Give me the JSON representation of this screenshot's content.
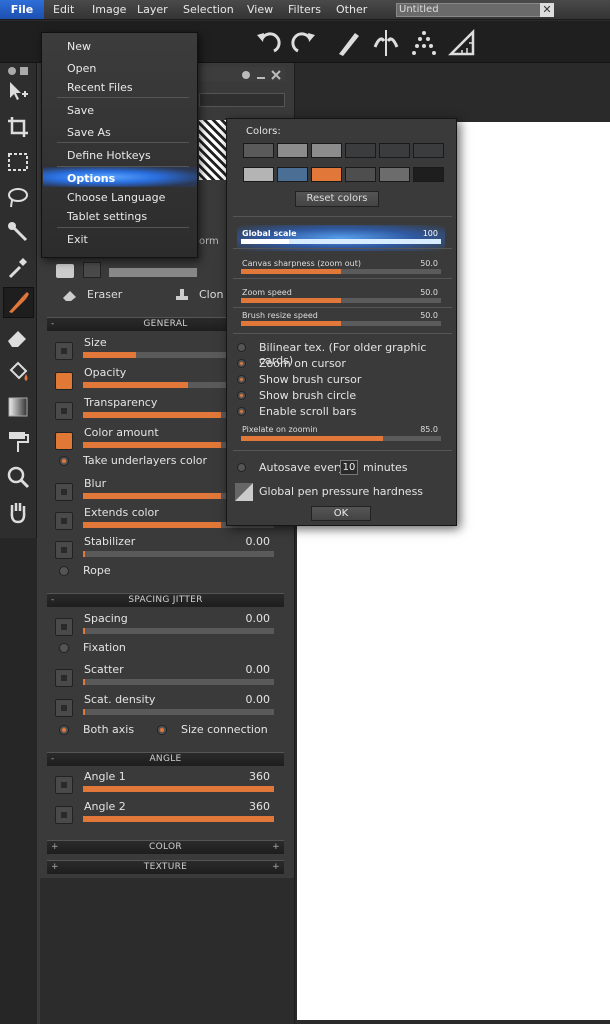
{
  "menubar": {
    "items": [
      "File",
      "Edit",
      "Image",
      "Layer",
      "Selection",
      "View",
      "Filters",
      "Other"
    ],
    "document_name": "Untitled",
    "close_glyph": "✕"
  },
  "file_menu": {
    "items": [
      "New",
      "Open",
      "Recent Files",
      "Save",
      "Save As",
      "Define Hotkeys",
      "Options",
      "Choose Language",
      "Tablet settings",
      "Exit"
    ],
    "highlighted": "Options"
  },
  "partial_panel_text": {
    "form_fragment": "orm",
    "eraser": "Eraser",
    "clone_fragment": "Clon"
  },
  "sections": {
    "general": "GENERAL",
    "spacing_jitter": "SPACING JITTER",
    "angle": "ANGLE",
    "color": "COLOR",
    "texture": "TEXTURE",
    "minus": "-",
    "plus": "+"
  },
  "general_rows": [
    {
      "label": "Size",
      "value": "",
      "fill": 0.28,
      "orange": false
    },
    {
      "label": "Opacity",
      "value": "",
      "fill": 0.55,
      "orange": true
    },
    {
      "label": "Transparency",
      "value": "",
      "fill": 0.72,
      "orange": false
    },
    {
      "label": "Color amount",
      "value": "",
      "fill": 0.72,
      "orange": true
    },
    {
      "label": "Blur",
      "value": "",
      "fill": 0.72,
      "orange": false
    },
    {
      "label": "Extends color",
      "value": "",
      "fill": 0.72,
      "orange": false
    },
    {
      "label": "Stabilizer",
      "value": "0.00",
      "fill": 0.01,
      "orange": false
    }
  ],
  "general_radios": {
    "underlayers": "Take underlayers color",
    "rope": "Rope"
  },
  "spacing_rows": [
    {
      "label": "Spacing",
      "value": "0.00",
      "fill": 0.01
    },
    {
      "label": "Scatter",
      "value": "0.00",
      "fill": 0.01
    },
    {
      "label": "Scat. density",
      "value": "0.00",
      "fill": 0.01
    }
  ],
  "spacing_radios": {
    "fixation": "Fixation",
    "both_axis": "Both axis",
    "size_connection": "Size connection"
  },
  "angle_rows": [
    {
      "label": "Angle 1",
      "value": "360",
      "fill": 1.0
    },
    {
      "label": "Angle 2",
      "value": "360",
      "fill": 1.0
    }
  ],
  "options_dialog": {
    "colors_label": "Colors:",
    "swatches_row1": [
      "#5a5a5a",
      "#8c8c8c",
      "#8c8c8c",
      "#3a3c3e",
      "#3a3c3e",
      "#3a3c3e"
    ],
    "swatches_row2": [
      "#b4b4b4",
      "#4a6e94",
      "#e2773a",
      "#4e4e4e",
      "#6c6c6c",
      "#1e1e1e"
    ],
    "reset_colors": "Reset colors",
    "sliders": [
      {
        "label": "Global scale",
        "value": "100",
        "fill": 0.24
      },
      {
        "label": "Canvas sharpness (zoom out)",
        "value": "50.0",
        "fill": 0.5
      },
      {
        "label": "Zoom speed",
        "value": "50.0",
        "fill": 0.5
      },
      {
        "label": "Brush resize speed",
        "value": "50.0",
        "fill": 0.5
      }
    ],
    "options": [
      {
        "label": "Bilinear tex. (For older graphic cards)",
        "on": false
      },
      {
        "label": "Zoom on cursor",
        "on": true
      },
      {
        "label": "Show brush cursor",
        "on": true
      },
      {
        "label": "Show brush circle",
        "on": true
      },
      {
        "label": "Enable scroll bars",
        "on": true
      }
    ],
    "pixelate": {
      "label": "Pixelate on zoomin",
      "value": "85.0",
      "fill": 0.71
    },
    "autosave_prefix": "Autosave every",
    "autosave_minutes": "10",
    "autosave_suffix": "minutes",
    "pen_pressure": "Global pen pressure hardness",
    "ok": "OK"
  },
  "colors": {
    "accent_orange": "#e2773a",
    "highlight_blue": "#2a6fe0",
    "menu_file_active": "#1d4fb0"
  }
}
